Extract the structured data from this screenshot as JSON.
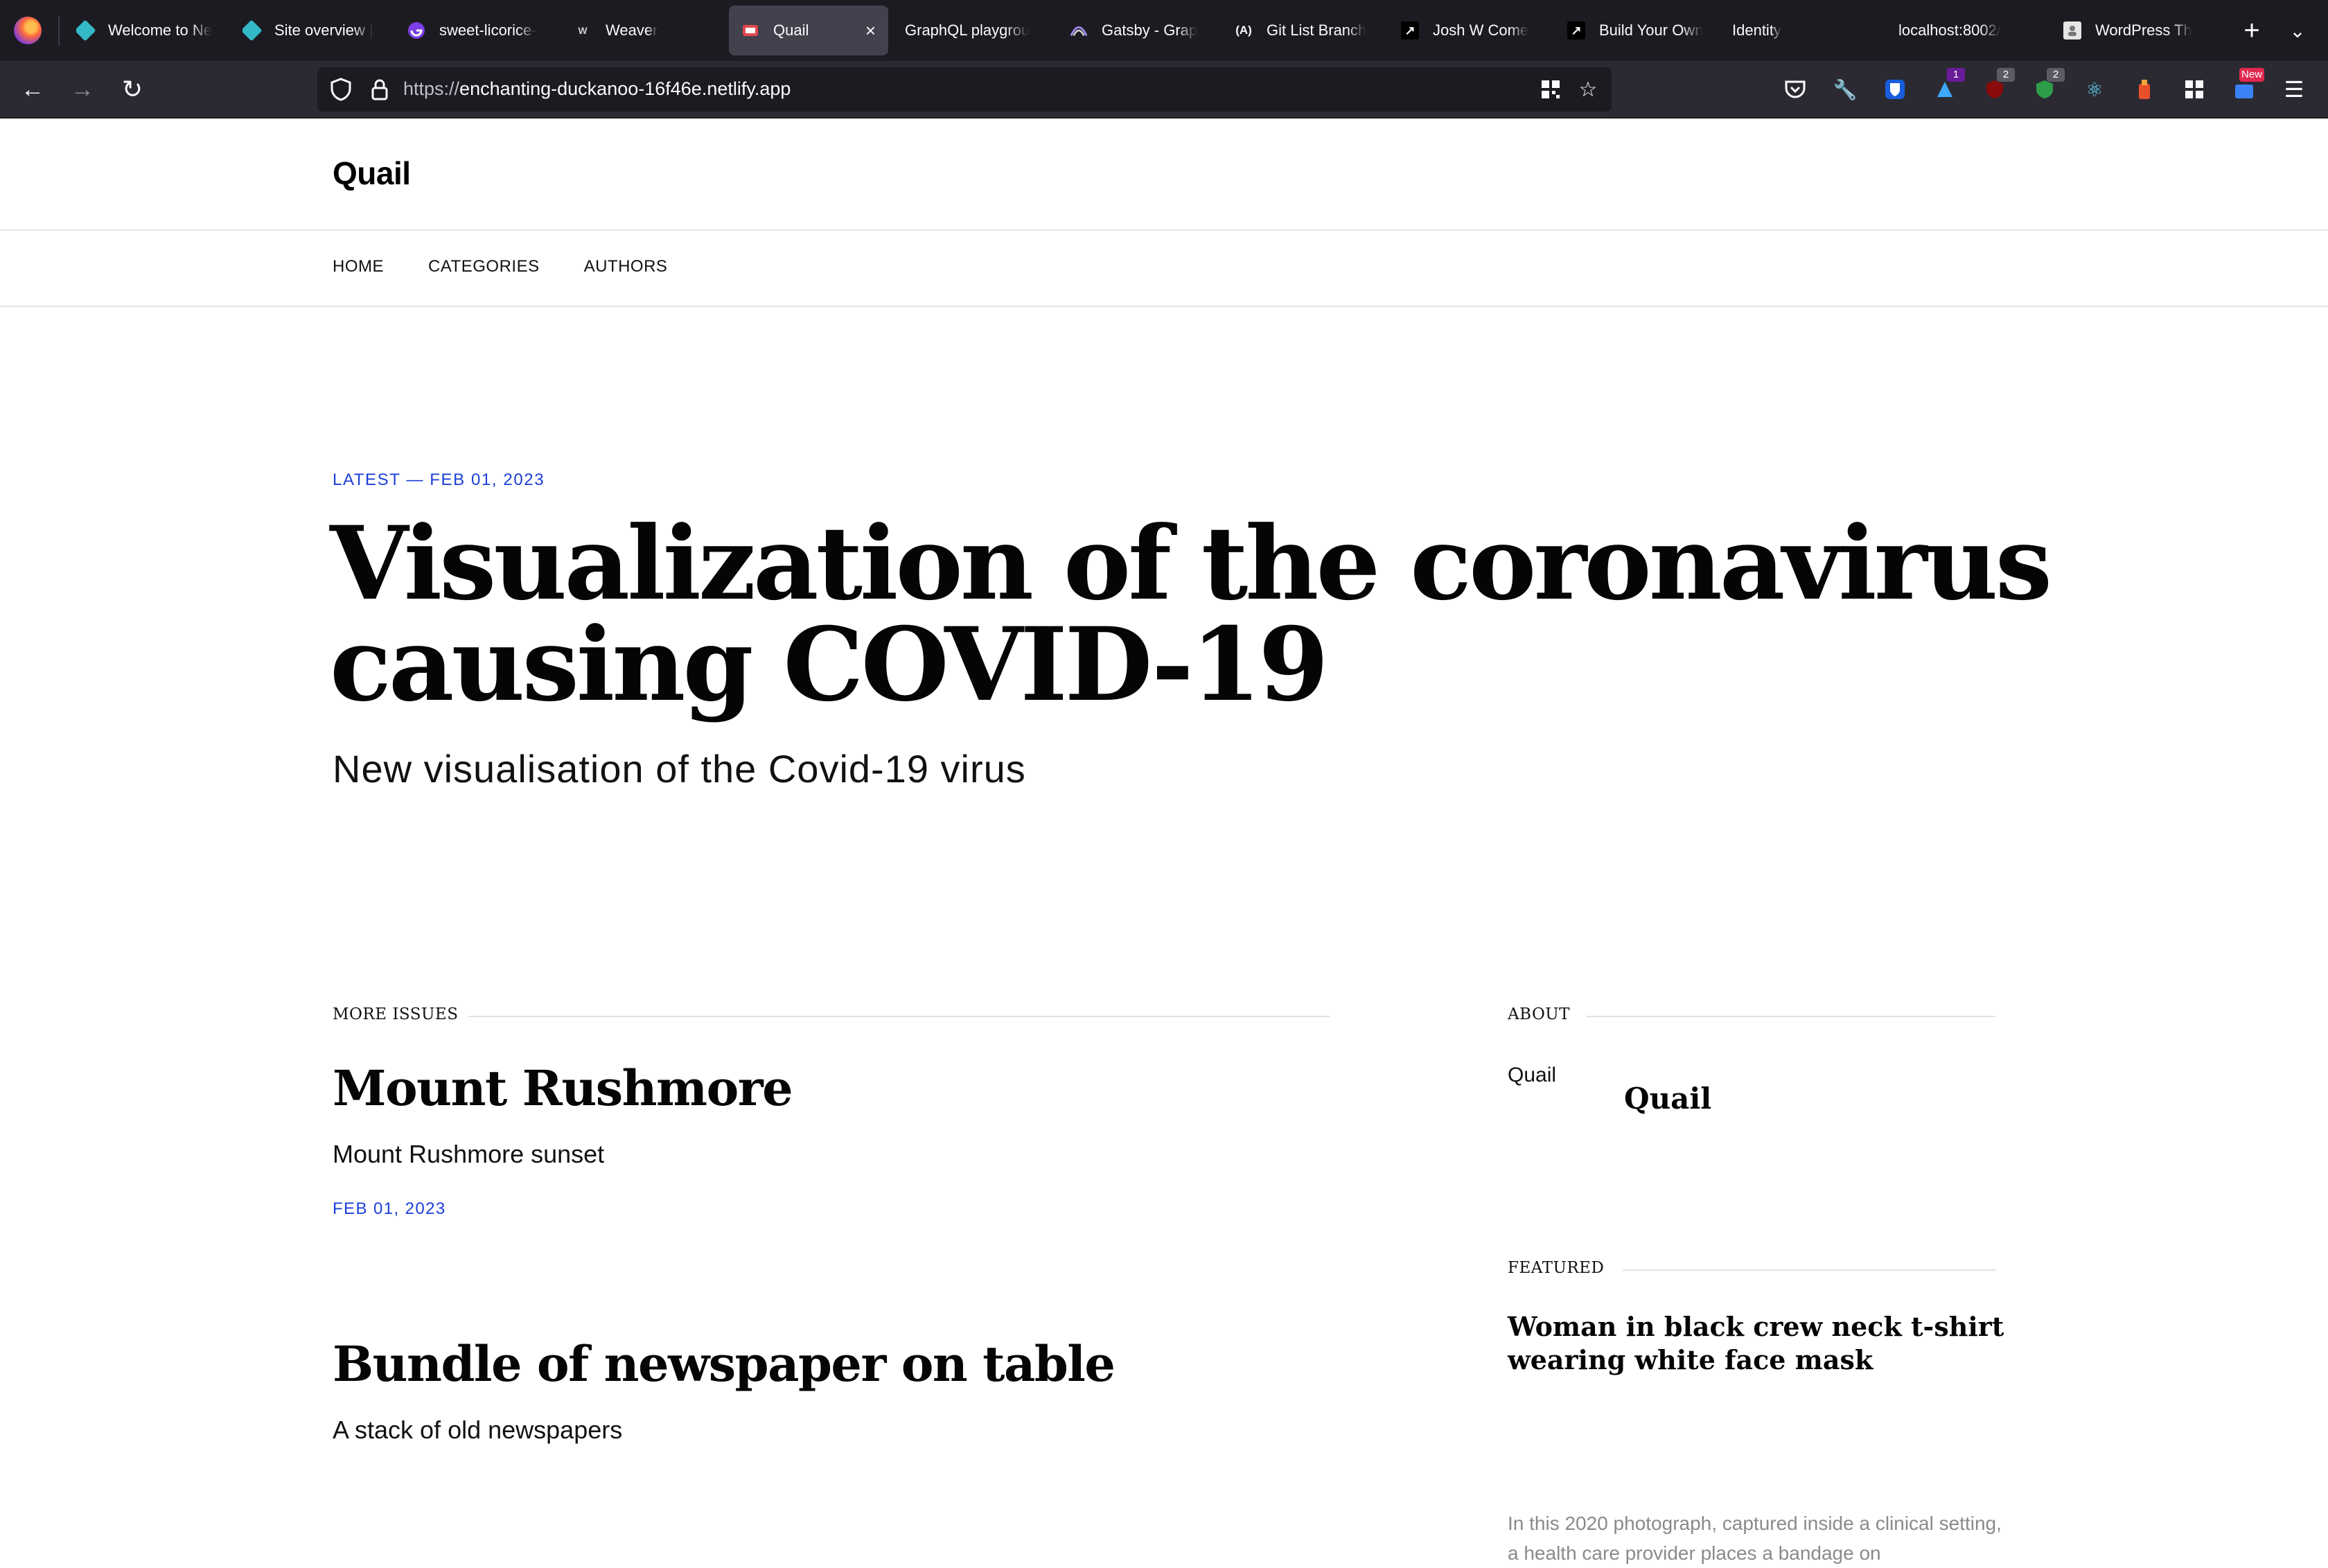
{
  "browser": {
    "tabs": [
      {
        "title": "Welcome to Ne",
        "favicon": "netlify-diamond",
        "active": false
      },
      {
        "title": "Site overview |",
        "favicon": "netlify-diamond",
        "active": false
      },
      {
        "title": "sweet-licorice-",
        "favicon": "gatsby-icon",
        "active": false
      },
      {
        "title": "Weaver",
        "favicon": "w-icon",
        "active": false
      },
      {
        "title": "Quail",
        "favicon": "quail-icon",
        "active": true
      },
      {
        "title": "GraphQL playgrou",
        "favicon": "",
        "active": false
      },
      {
        "title": "Gatsby - Grap",
        "favicon": "gatsby-icon",
        "active": false
      },
      {
        "title": "Git List Branch",
        "favicon": "a-icon",
        "active": false
      },
      {
        "title": "Josh W Come",
        "favicon": "arrow-icon",
        "active": false
      },
      {
        "title": "Build Your Own",
        "favicon": "arrow-icon",
        "active": false
      },
      {
        "title": "Identity",
        "favicon": "",
        "active": false
      },
      {
        "title": "localhost:8002/",
        "favicon": "",
        "active": false
      },
      {
        "title": "WordPress Th",
        "favicon": "wordpress-icon",
        "active": false
      }
    ],
    "url_scheme": "https://",
    "url_host": "enchanting-duckanoo-16f46e.netlify.app",
    "extension_badges": {
      "one": "1",
      "two_a": "2",
      "two_b": "2",
      "new": "New"
    }
  },
  "site": {
    "title": "Quail",
    "nav": {
      "home": "HOME",
      "categories": "CATEGORIES",
      "authors": "AUTHORS"
    }
  },
  "hero": {
    "eyebrow": "LATEST — FEB 01, 2023",
    "title_line1": "Visualization of the coronavirus",
    "title_line2": "causing COVID-19",
    "subtitle": "New visualisation of the Covid-19 virus"
  },
  "more_issues": {
    "label": "MORE ISSUES",
    "posts": [
      {
        "title": "Mount Rushmore",
        "excerpt": "Mount Rushmore sunset",
        "date": "FEB 01, 2023"
      },
      {
        "title": "Bundle of newspaper on table",
        "excerpt": "A stack of old newspapers"
      }
    ]
  },
  "about": {
    "label": "ABOUT",
    "text": "Quail",
    "brand": "Quail"
  },
  "featured": {
    "label": "FEATURED",
    "title": "Woman in black crew neck t-shirt wearing white face mask",
    "excerpt": "In this 2020 photograph, captured inside a clinical setting, a health care provider places a bandage on"
  }
}
